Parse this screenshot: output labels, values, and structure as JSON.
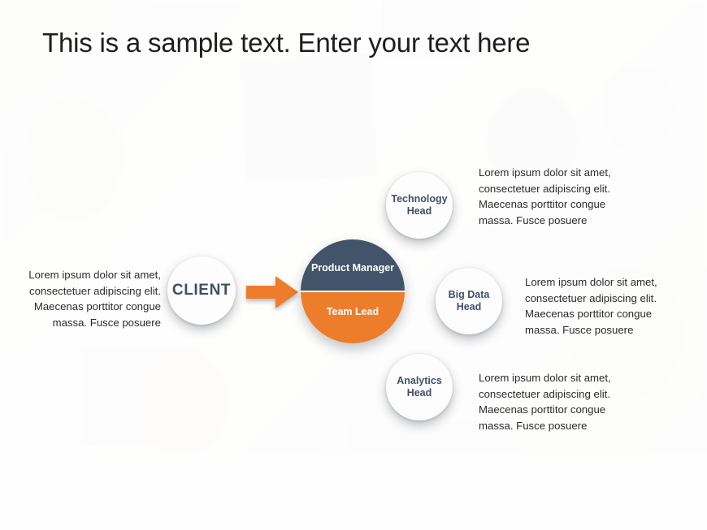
{
  "slide": {
    "title": "This is a sample text. Enter your text here",
    "background_description": "faded blurred office teamwork photo"
  },
  "colors": {
    "accent_orange": "#ed7d2b",
    "accent_navy": "#42536a",
    "node_text": "#3f5068",
    "body_text": "#2b2b2b",
    "title_text": "#1e1e1e",
    "node_fill": "#fdfdfd"
  },
  "diagram": {
    "client": {
      "label": "CLIENT",
      "description": "Lorem ipsum dolor sit amet, consectetuer adipiscing elit. Maecenas porttitor congue massa. Fusce posuere"
    },
    "arrow": {
      "icon": "arrow-right-icon",
      "color": "#ed7d2b"
    },
    "center": {
      "top_label": "Product Manager",
      "bottom_label": "Team Lead"
    },
    "satellites": [
      {
        "id": "technology-head",
        "label": "Technology Head",
        "description": "Lorem ipsum dolor sit amet, consectetuer adipiscing elit. Maecenas porttitor congue massa. Fusce posuere"
      },
      {
        "id": "big-data-head",
        "label": "Big Data Head",
        "description": "Lorem ipsum dolor sit amet, consectetuer adipiscing elit. Maecenas porttitor congue massa. Fusce posuere"
      },
      {
        "id": "analytics-head",
        "label": "Analytics Head",
        "description": "Lorem ipsum dolor sit amet, consectetuer adipiscing elit. Maecenas porttitor congue massa. Fusce posuere"
      }
    ]
  }
}
